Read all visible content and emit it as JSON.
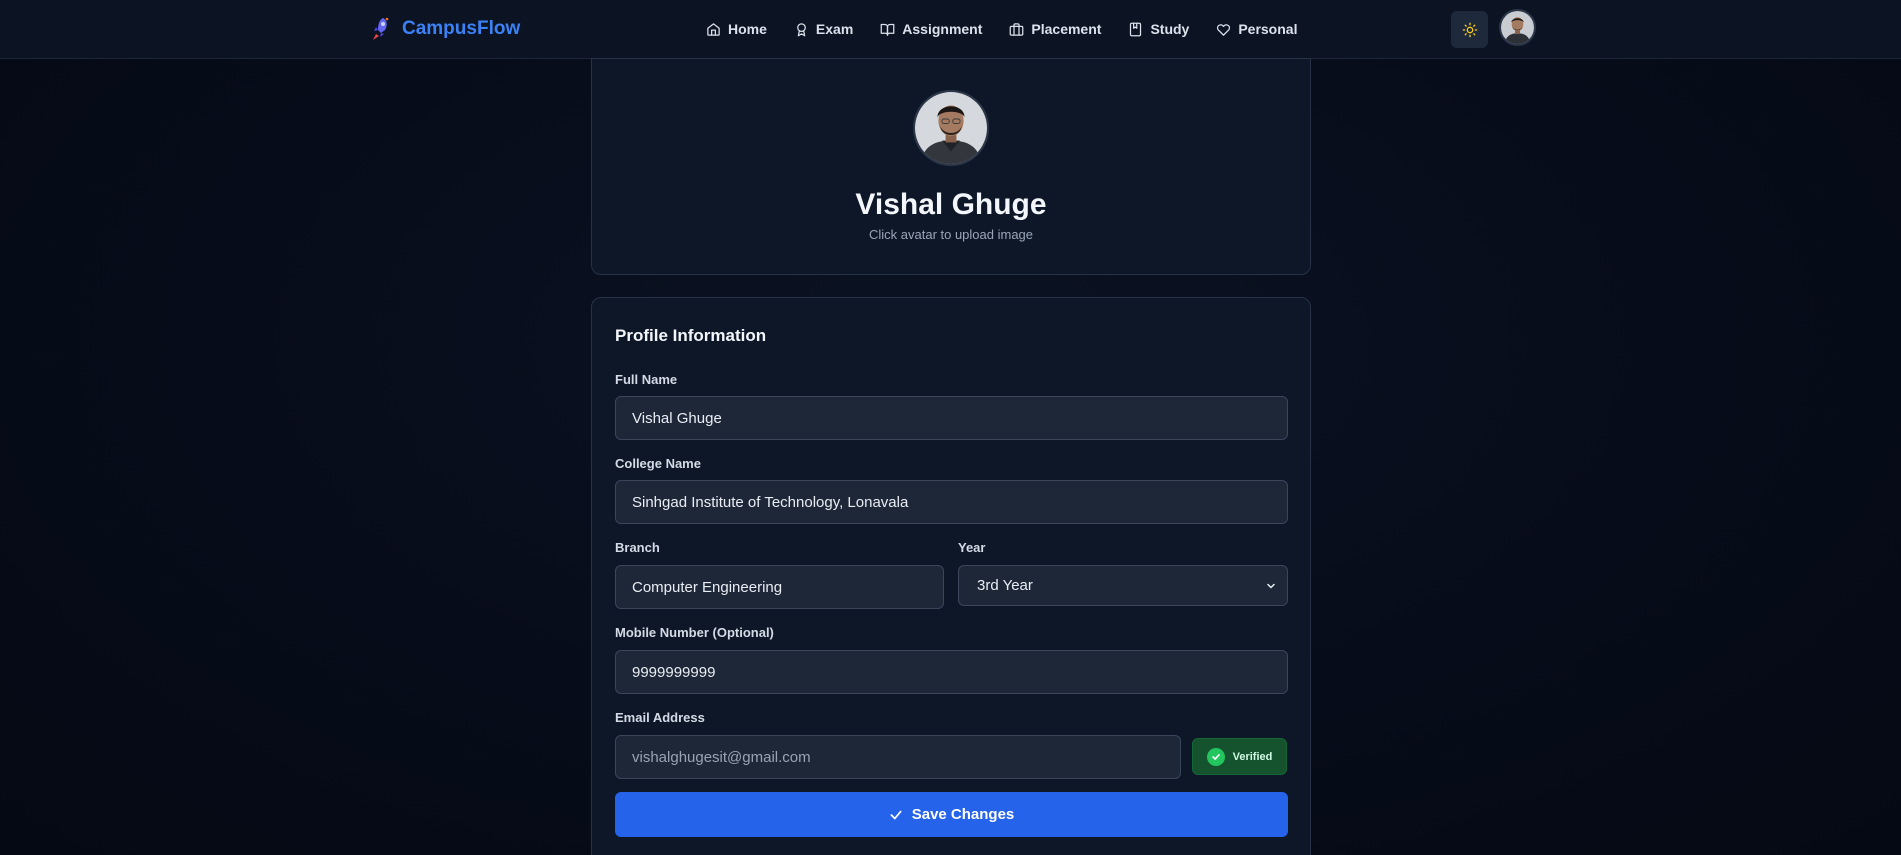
{
  "header": {
    "brand_name": "CampusFlow",
    "brand_icon": "rocket-icon",
    "nav": [
      {
        "label": "Home",
        "icon": "home-icon"
      },
      {
        "label": "Exam",
        "icon": "award-icon"
      },
      {
        "label": "Assignment",
        "icon": "book-open-icon"
      },
      {
        "label": "Placement",
        "icon": "briefcase-icon"
      },
      {
        "label": "Study",
        "icon": "notebook-icon"
      },
      {
        "label": "Personal",
        "icon": "heart-icon"
      }
    ],
    "theme_toggle_icon": "sun-icon"
  },
  "profile": {
    "name": "Vishal Ghuge",
    "hint": "Click avatar to upload image"
  },
  "form": {
    "title": "Profile Information",
    "full_name": {
      "label": "Full Name",
      "value": "Vishal Ghuge"
    },
    "college": {
      "label": "College Name",
      "value": "Sinhgad Institute of Technology, Lonavala"
    },
    "branch": {
      "label": "Branch",
      "value": "Computer Engineering"
    },
    "year": {
      "label": "Year",
      "value": "3rd Year"
    },
    "mobile": {
      "label": "Mobile Number (Optional)",
      "value": "9999999999"
    },
    "email": {
      "label": "Email Address",
      "value": "vishalghugesit@gmail.com",
      "status": "Verified"
    },
    "save_label": "Save Changes"
  },
  "colors": {
    "accent": "#2563eb",
    "brand": "#3b82f6",
    "verified": "#22c55e"
  }
}
